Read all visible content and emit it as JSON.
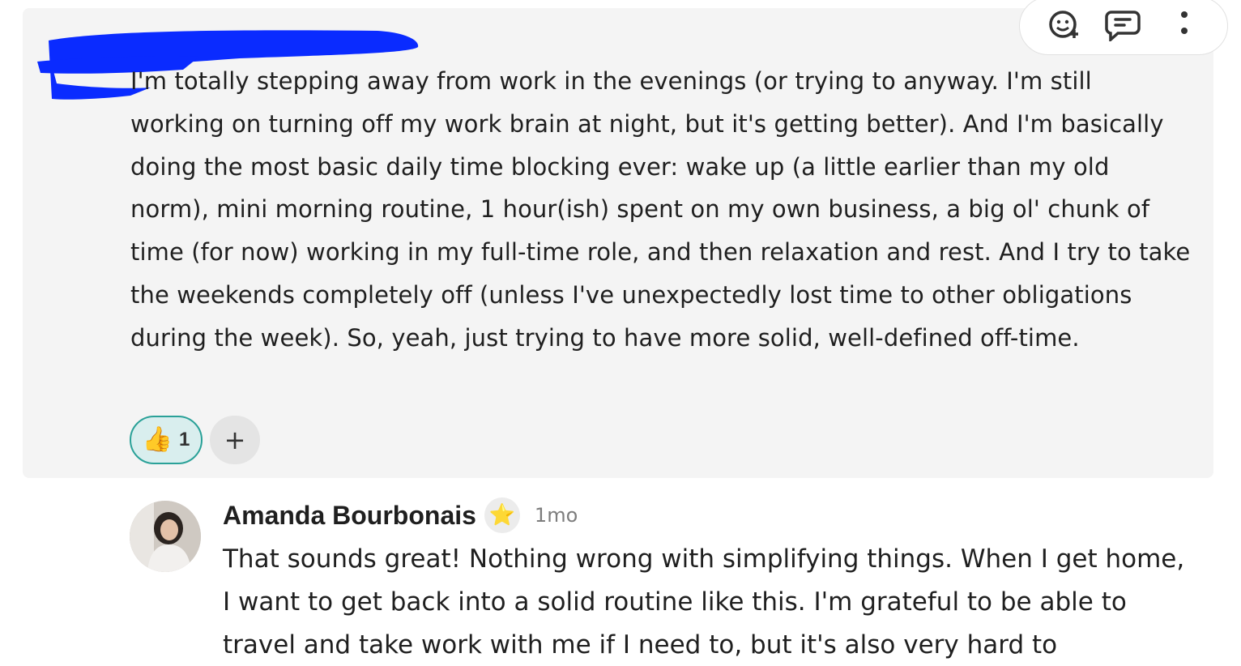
{
  "post": {
    "body": "I'm totally stepping away from work in the evenings (or trying to anyway. I'm still working on turning off my work brain at night, but it's getting better). And I'm basically doing the most basic daily time blocking ever: wake up (a little earlier than my old norm), mini morning routine, 1 hour(ish) spent on my own business, a big ol' chunk of time (for now) working in my full-time role, and then relaxation and rest. And I try to take the weekends completely off (unless I've unexpectedly lost time to other obligations during the week). So, yeah, just trying to have more solid, well-defined off-time.",
    "reactions": [
      {
        "emoji": "👍",
        "count": "1",
        "icon": "thumbs-up-icon",
        "selected": true
      }
    ],
    "add_reaction_label": "+",
    "actions": {
      "react_icon": "add-emoji-icon",
      "reply_icon": "reply-bubble-icon",
      "more_icon": "more-vertical-icon"
    },
    "accent_color": "#2aa198",
    "redaction_color": "#0a2bff"
  },
  "reply": {
    "author": "Amanda Bourbonais",
    "badge": "⭐",
    "badge_icon": "star-badge-icon",
    "timestamp": "1mo",
    "body": "That sounds great! Nothing wrong with simplifying things. When I get home, I want to get back into a solid routine like this. I'm grateful to be able to travel and take work with me if I need to, but it's also very hard to"
  }
}
